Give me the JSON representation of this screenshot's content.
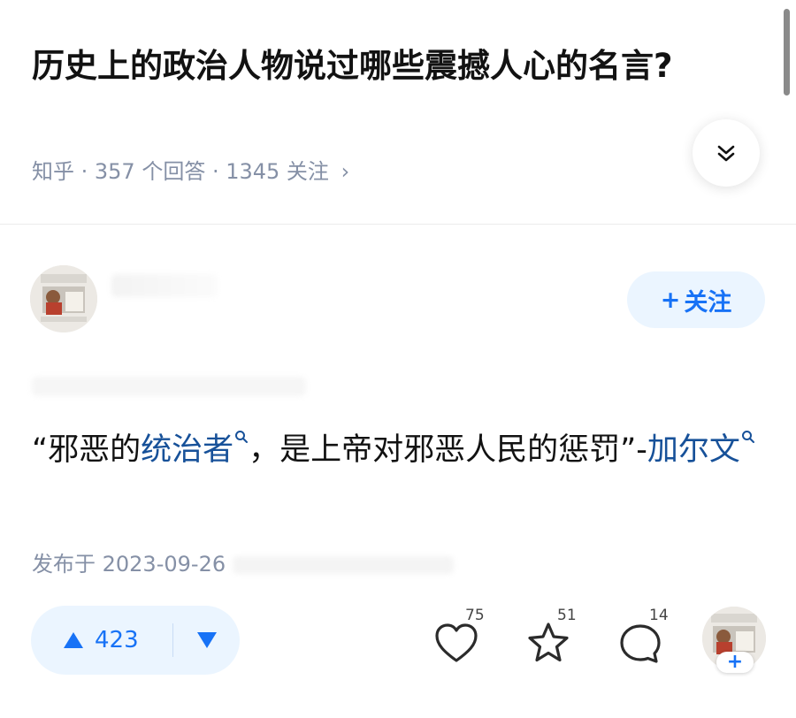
{
  "question": {
    "title": "历史上的政治人物说过哪些震撼人心的名言?",
    "meta": "知乎 · 357 个回答 · 1345 关注",
    "meta_arrow": "›"
  },
  "author": {
    "follow_label": "关注",
    "follow_plus": "+"
  },
  "answer": {
    "text_open": "“邪恶的",
    "link1": "统治者",
    "text_mid": "，是上帝对邪恶人民的惩罚”-",
    "link2": "加尔文",
    "published": "发布于 2023-09-26"
  },
  "actions": {
    "upvote_count": "423",
    "likes": "75",
    "favorites": "51",
    "comments": "14",
    "author_follow_plus": "+"
  },
  "colors": {
    "brand_blue": "#1772f6",
    "link_blue": "#175199",
    "meta_gray": "#8590a6",
    "vote_bg": "#ebf5ff"
  }
}
